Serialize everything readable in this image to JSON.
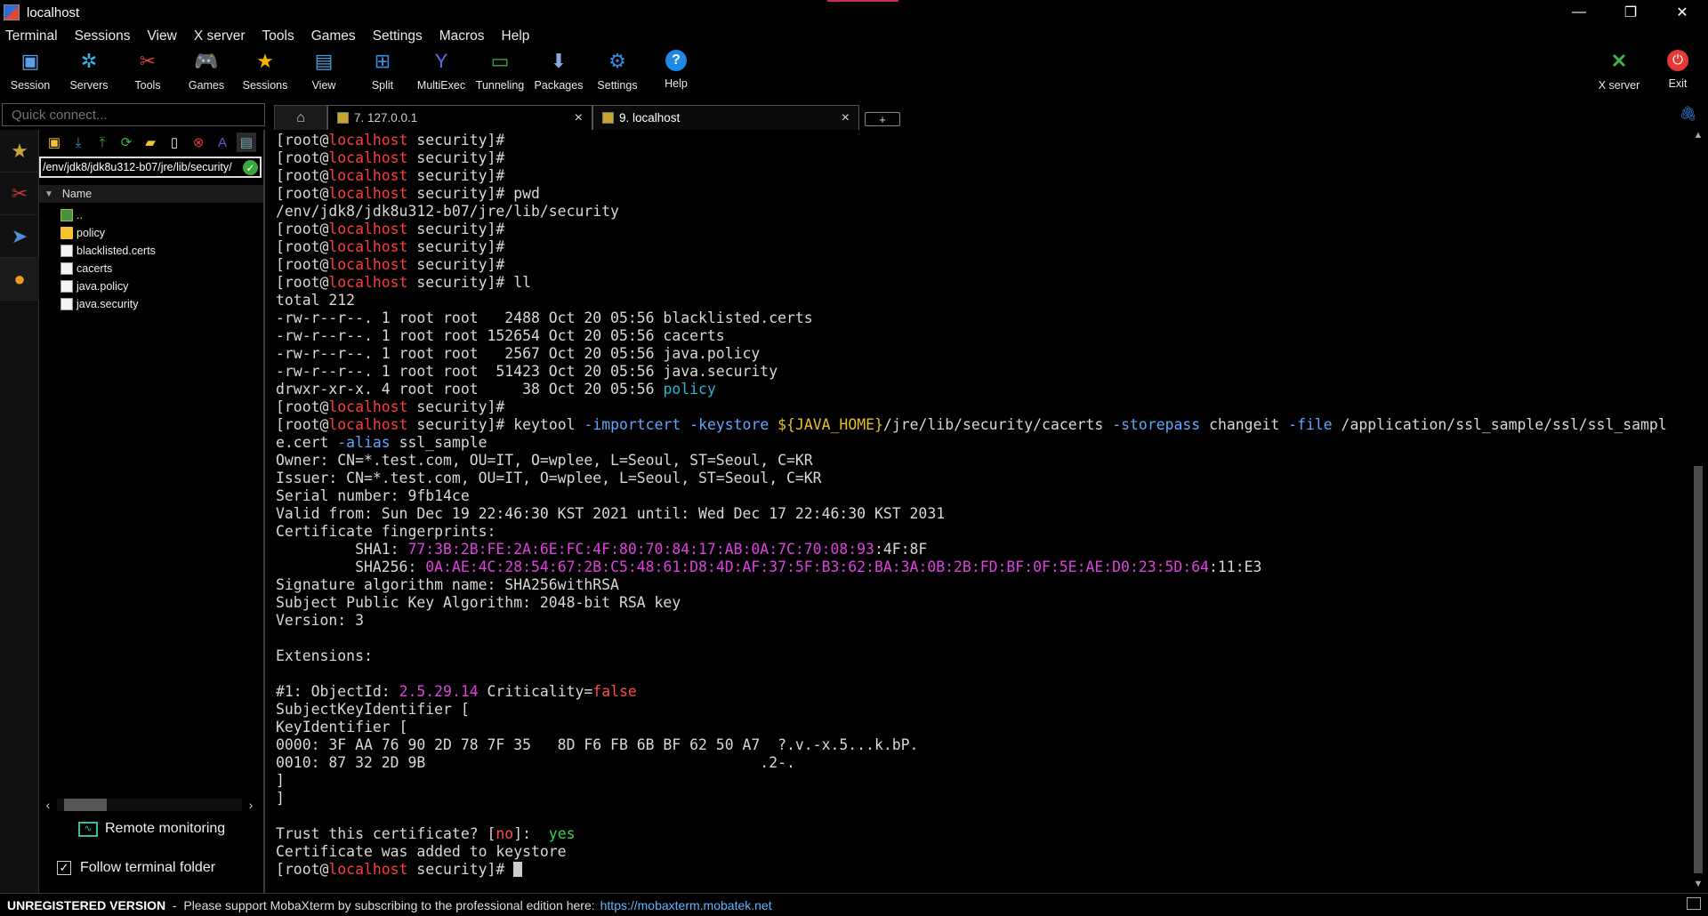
{
  "window": {
    "title": "localhost",
    "controls": [
      "—",
      "❐",
      "✕"
    ]
  },
  "menu": [
    "Terminal",
    "Sessions",
    "View",
    "X server",
    "Tools",
    "Games",
    "Settings",
    "Macros",
    "Help"
  ],
  "toolbar": {
    "session": "Session",
    "servers": "Servers",
    "tools": "Tools",
    "games": "Games",
    "sessions": "Sessions",
    "view": "View",
    "split": "Split",
    "multiexec": "MultiExec",
    "tunneling": "Tunneling",
    "packages": "Packages",
    "settings": "Settings",
    "help": "Help",
    "xserver": "X server",
    "exit": "Exit"
  },
  "quick_connect": {
    "placeholder": "Quick connect..."
  },
  "tabs": [
    {
      "label": "7. 127.0.0.1"
    },
    {
      "label": "9. localhost"
    }
  ],
  "sftp": {
    "path": "/env/jdk8/jdk8u312-b07/jre/lib/security/",
    "column_header": "Name",
    "files": [
      "..",
      "policy",
      "blacklisted.certs",
      "cacerts",
      "java.policy",
      "java.security"
    ],
    "remote_monitoring": "Remote monitoring",
    "follow_folder": "Follow terminal folder"
  },
  "terminal": {
    "prompt_user": "[root@",
    "prompt_host": "localhost",
    "prompt_dir": " security]#",
    "pwd_output": "/env/jdk8/jdk8u312-b07/jre/lib/security",
    "ll_total": "total 212",
    "ll_rows": [
      "-rw-r--r--. 1 root root   2488 Oct 20 05:56 blacklisted.certs",
      "-rw-r--r--. 1 root root 152654 Oct 20 05:56 cacerts",
      "-rw-r--r--. 1 root root   2567 Oct 20 05:56 java.policy",
      "-rw-r--r--. 1 root root  51423 Oct 20 05:56 java.security"
    ],
    "ll_dir_row": "drwxr-xr-x. 4 root root     38 Oct 20 05:56 ",
    "ll_dir_name": "policy",
    "keytool_cmd_1": "keytool ",
    "keytool_cmd_2": "-importcert",
    "keytool_cmd_3": "-keystore",
    "keytool_cmd_4": "${JAVA_HOME}",
    "keytool_cmd_5": "/jre/lib/security/cacerts ",
    "keytool_cmd_6": "-storepass",
    "keytool_cmd_7": " changeit ",
    "keytool_cmd_8": "-file",
    "keytool_cmd_9": " /application/ssl_sample/ssl/ssl_sampl",
    "keytool_cmd_10": "e.cert ",
    "keytool_cmd_11": "-alias",
    "keytool_cmd_12": " ssl_sample",
    "owner": "Owner: CN=*.test.com, OU=IT, O=wplee, L=Seoul, ST=Seoul, C=KR",
    "issuer": "Issuer: CN=*.test.com, OU=IT, O=wplee, L=Seoul, ST=Seoul, C=KR",
    "serial": "Serial number: 9fb14ce",
    "valid": "Valid from: Sun Dec 19 22:46:30 KST 2021 until: Wed Dec 17 22:46:30 KST 2031",
    "fingerprints_hdr": "Certificate fingerprints:",
    "sha1_label": "         SHA1: ",
    "sha1_value": "77:3B:2B:FE:2A:6E:FC:4F:80:70:84:17:AB:0A:7C:70:08:93",
    "sha1_tail": ":4F:8F",
    "sha256_label": "         SHA256: ",
    "sha256_value": "0A:AE:4C:28:54:67:2B:C5:48:61:D8:4D:AF:37:5F:B3:62:BA:3A:0B:2B:FD:BF:0F:5E:AE:D0:23:5D:64",
    "sha256_tail": ":11:E3",
    "sig_alg": "Signature algorithm name: SHA256withRSA",
    "pubkey_alg": "Subject Public Key Algorithm: 2048-bit RSA key",
    "version": "Version: 3",
    "extensions": "Extensions:",
    "objectid_label": "#1: ObjectId: ",
    "objectid_value": "2.5.29.14",
    "criticality_label": " Criticality=",
    "criticality_value": "false",
    "ski": "SubjectKeyIdentifier [",
    "keyid": "KeyIdentifier [",
    "hex1": "0000: 3F AA 76 90 2D 78 7F 35   8D F6 FB 6B BF 62 50 A7  ?.v.-x.5...k.bP.",
    "hex2": "0010: 87 32 2D 9B                                      .2-.",
    "close1": "]",
    "close2": "]",
    "trust_q1": "Trust this certificate? [",
    "trust_no": "no",
    "trust_q2": "]:  ",
    "trust_yes": "yes",
    "added": "Certificate was added to keystore",
    "cmd_pwd": " pwd",
    "cmd_ll": " ll",
    "cmd_space": " "
  },
  "statusbar": {
    "unregistered": "UNREGISTERED VERSION",
    "message": "  -  Please support MobaXterm by subscribing to the professional edition here:",
    "link": "https://mobaxterm.mobatek.net"
  },
  "colors": {
    "host": "#ff3b3b",
    "link": "#5fb4ff",
    "fingerprint": "#e040e0",
    "option": "#5fa6ff",
    "variable": "#e1c02f"
  }
}
